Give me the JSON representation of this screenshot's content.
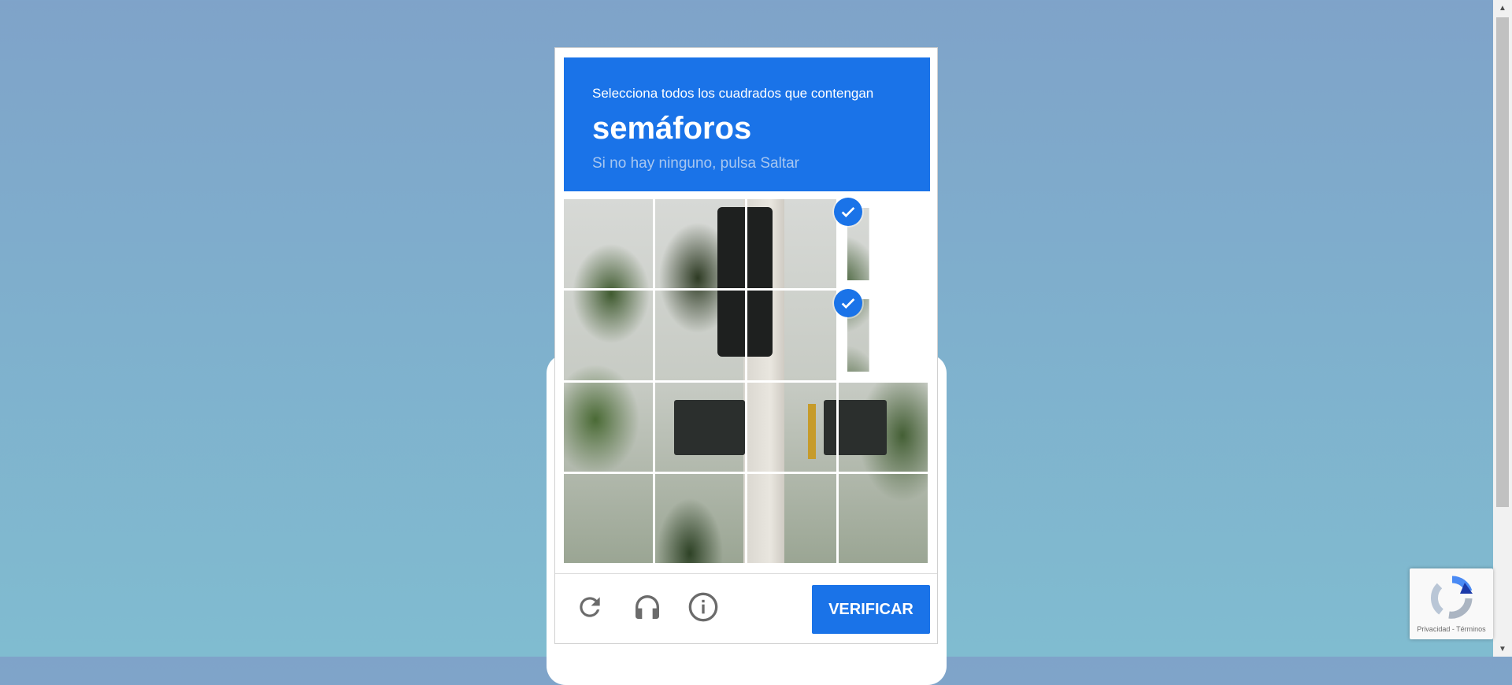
{
  "challenge": {
    "instruction": "Selecciona todos los cuadrados que contengan",
    "target": "semáforos",
    "hint": "Si no hay ninguno, pulsa Saltar",
    "header_color": "#1a73e8",
    "grid": {
      "rows": 4,
      "cols": 4,
      "selected_tiles": [
        3,
        7
      ]
    }
  },
  "footer": {
    "reload_icon": "reload-icon",
    "audio_icon": "headphones-icon",
    "info_icon": "info-icon",
    "verify_label": "VERIFICAR"
  },
  "badge": {
    "links": "Privacidad - Términos"
  }
}
